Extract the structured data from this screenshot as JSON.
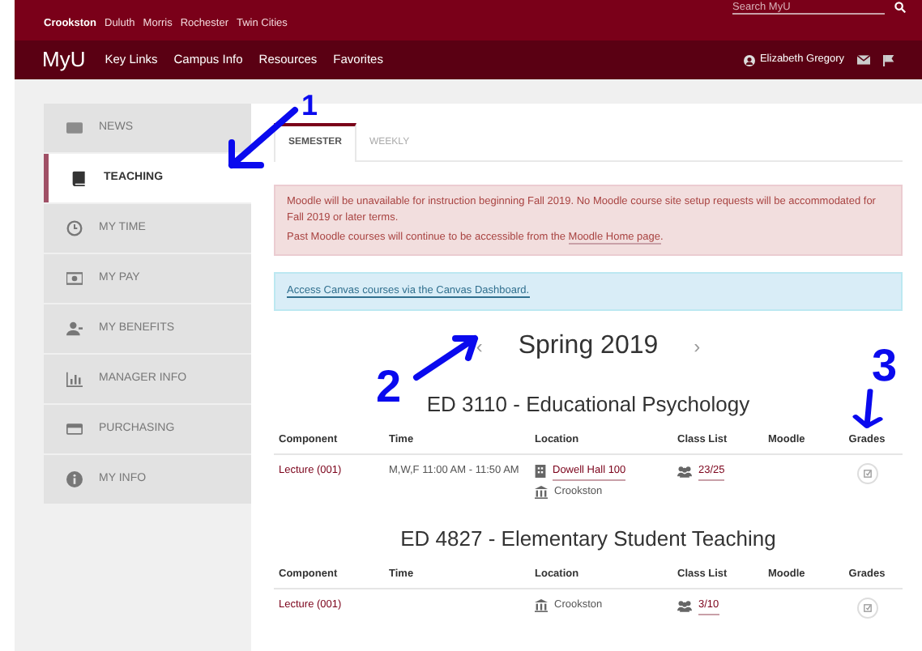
{
  "campuses": [
    {
      "label": "Crookston",
      "selected": true
    },
    {
      "label": "Duluth",
      "selected": false
    },
    {
      "label": "Morris",
      "selected": false
    },
    {
      "label": "Rochester",
      "selected": false
    },
    {
      "label": "Twin Cities",
      "selected": false
    }
  ],
  "search": {
    "placeholder": "Search MyU"
  },
  "nav": {
    "logo": "MyU",
    "links": [
      "Key Links",
      "Campus Info",
      "Resources",
      "Favorites"
    ],
    "user": "Elizabeth Gregory"
  },
  "sidebar": {
    "items": [
      {
        "label": "NEWS",
        "kind": "news",
        "selected": false
      },
      {
        "label": "TEACHING",
        "kind": "book",
        "selected": true
      },
      {
        "label": "MY TIME",
        "kind": "clock",
        "selected": false
      },
      {
        "label": "MY PAY",
        "kind": "money",
        "selected": false
      },
      {
        "label": "MY BENEFITS",
        "kind": "user",
        "selected": false
      },
      {
        "label": "MANAGER INFO",
        "kind": "chart",
        "selected": false
      },
      {
        "label": "PURCHASING",
        "kind": "card",
        "selected": false
      },
      {
        "label": "MY INFO",
        "kind": "info",
        "selected": false
      }
    ]
  },
  "tabs": [
    {
      "label": "SEMESTER",
      "selected": true
    },
    {
      "label": "WEEKLY",
      "selected": false
    }
  ],
  "alert_warning": {
    "lines": [
      "Moodle will be unavailable for instruction beginning Fall 2019. No Moodle course site setup requests will be accommodated for Fall 2019 or later terms."
    ],
    "prefix": "Past Moodle courses will continue to be accessible from the ",
    "link": "Moodle Home page",
    "suffix": "."
  },
  "alert_info": {
    "link": "Access Canvas courses via the Canvas Dashboard."
  },
  "term": {
    "prev": "‹",
    "title": "Spring 2019",
    "next": "›"
  },
  "courses": [
    {
      "title": "ED 3110 - Educational Psychology",
      "columns": [
        "Component",
        "Time",
        "Location",
        "Class List",
        "Moodle",
        "Grades"
      ],
      "rows": [
        {
          "component": "Lecture (001)",
          "time": "M,W,F 11:00 AM - 11:50 AM",
          "building": "Dowell Hall 100",
          "campus": "Crookston",
          "class_list": "23/25"
        }
      ]
    },
    {
      "title": "ED 4827 - Elementary Student Teaching",
      "columns": [
        "Component",
        "Time",
        "Location",
        "Class List",
        "Moodle",
        "Grades"
      ],
      "rows": [
        {
          "component": "Lecture (001)",
          "campus": "Crookston",
          "class_list": "3/10"
        }
      ]
    }
  ],
  "annotations": [
    "1",
    "2",
    "3"
  ]
}
